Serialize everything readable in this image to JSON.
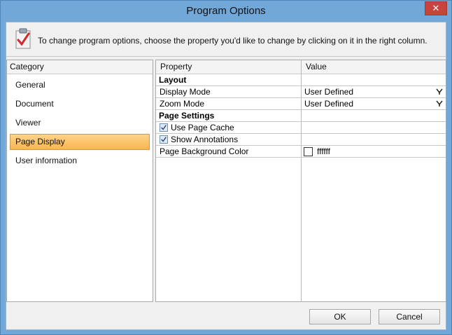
{
  "window": {
    "title": "Program Options",
    "close_label": "✕"
  },
  "info": {
    "text": "To change program options, choose the property you'd like to change by clicking on it in the right column."
  },
  "category": {
    "header": "Category",
    "items": [
      {
        "label": "General"
      },
      {
        "label": "Document"
      },
      {
        "label": "Viewer"
      },
      {
        "label": "Page Display",
        "selected": true
      },
      {
        "label": "User information"
      }
    ]
  },
  "grid": {
    "header_property": "Property",
    "header_value": "Value",
    "layout_section": "Layout",
    "display_mode": {
      "label": "Display Mode",
      "value": "User Defined"
    },
    "zoom_mode": {
      "label": "Zoom Mode",
      "value": "User Defined"
    },
    "page_settings_section": "Page Settings",
    "use_page_cache": {
      "label": "Use Page Cache",
      "checked": true
    },
    "show_annotations": {
      "label": "Show Annotations",
      "checked": true
    },
    "page_bg_color": {
      "label": "Page Background Color",
      "value": "ffffff",
      "swatch": "#ffffff"
    }
  },
  "buttons": {
    "ok": "OK",
    "cancel": "Cancel"
  }
}
